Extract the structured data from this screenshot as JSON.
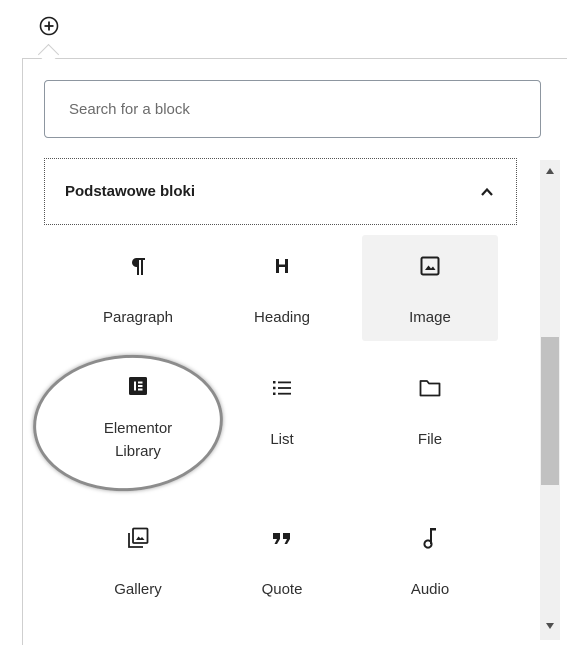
{
  "inserter_toggle": {
    "icon": "plus-circle-icon"
  },
  "search": {
    "placeholder": "Search for a block",
    "value": ""
  },
  "category": {
    "label": "Podstawowe bloki",
    "expanded": true
  },
  "blocks": [
    {
      "label": "Paragraph",
      "icon": "paragraph-icon",
      "hovered": false
    },
    {
      "label": "Heading",
      "icon": "heading-icon",
      "hovered": false
    },
    {
      "label": "Image",
      "icon": "image-icon",
      "hovered": true
    },
    {
      "label": "Elementor Library",
      "icon": "elementor-icon",
      "hovered": false,
      "circled": true
    },
    {
      "label": "List",
      "icon": "list-icon",
      "hovered": false
    },
    {
      "label": "File",
      "icon": "folder-icon",
      "hovered": false
    },
    {
      "label": "Gallery",
      "icon": "gallery-icon",
      "hovered": false
    },
    {
      "label": "Quote",
      "icon": "quote-icon",
      "hovered": false
    },
    {
      "label": "Audio",
      "icon": "music-note-icon",
      "hovered": false
    }
  ],
  "colors": {
    "accent_border": "#8d96a0",
    "hover_bg": "#f2f2f2",
    "icon": "#1e1e1e"
  }
}
